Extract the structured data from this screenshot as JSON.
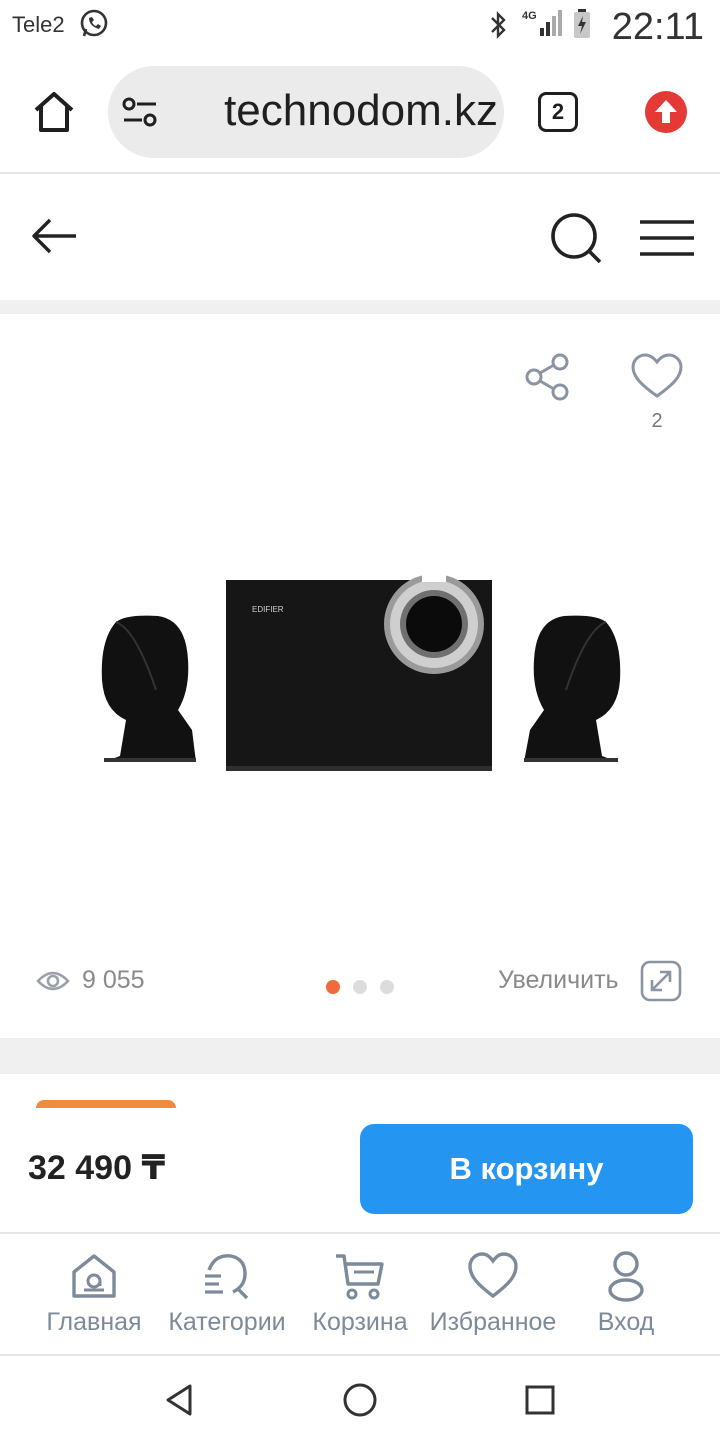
{
  "status_bar": {
    "carrier": "Tele2",
    "network": "4G",
    "time": "22:11"
  },
  "browser": {
    "url": "technodom.kz",
    "tab_count": "2"
  },
  "product": {
    "favorites_count": "2",
    "views": "9 055",
    "zoom_label": "Увеличить",
    "gallery_total_images": 3,
    "gallery_active_index": 0,
    "brand_on_image": "EDIFIER",
    "price": "32 490 ₸",
    "add_to_cart_label": "В корзину"
  },
  "bottom_nav": {
    "items": [
      {
        "label": "Главная",
        "icon": "home-icon"
      },
      {
        "label": "Категории",
        "icon": "categories-icon"
      },
      {
        "label": "Корзина",
        "icon": "cart-icon"
      },
      {
        "label": "Избранное",
        "icon": "heart-icon"
      },
      {
        "label": "Вход",
        "icon": "user-icon"
      }
    ]
  },
  "colors": {
    "accent_blue": "#2496f2",
    "active_dot": "#f06a3c",
    "promo_orange": "#f08a3c",
    "update_red": "#e53935",
    "nav_text": "#7d8a99"
  }
}
